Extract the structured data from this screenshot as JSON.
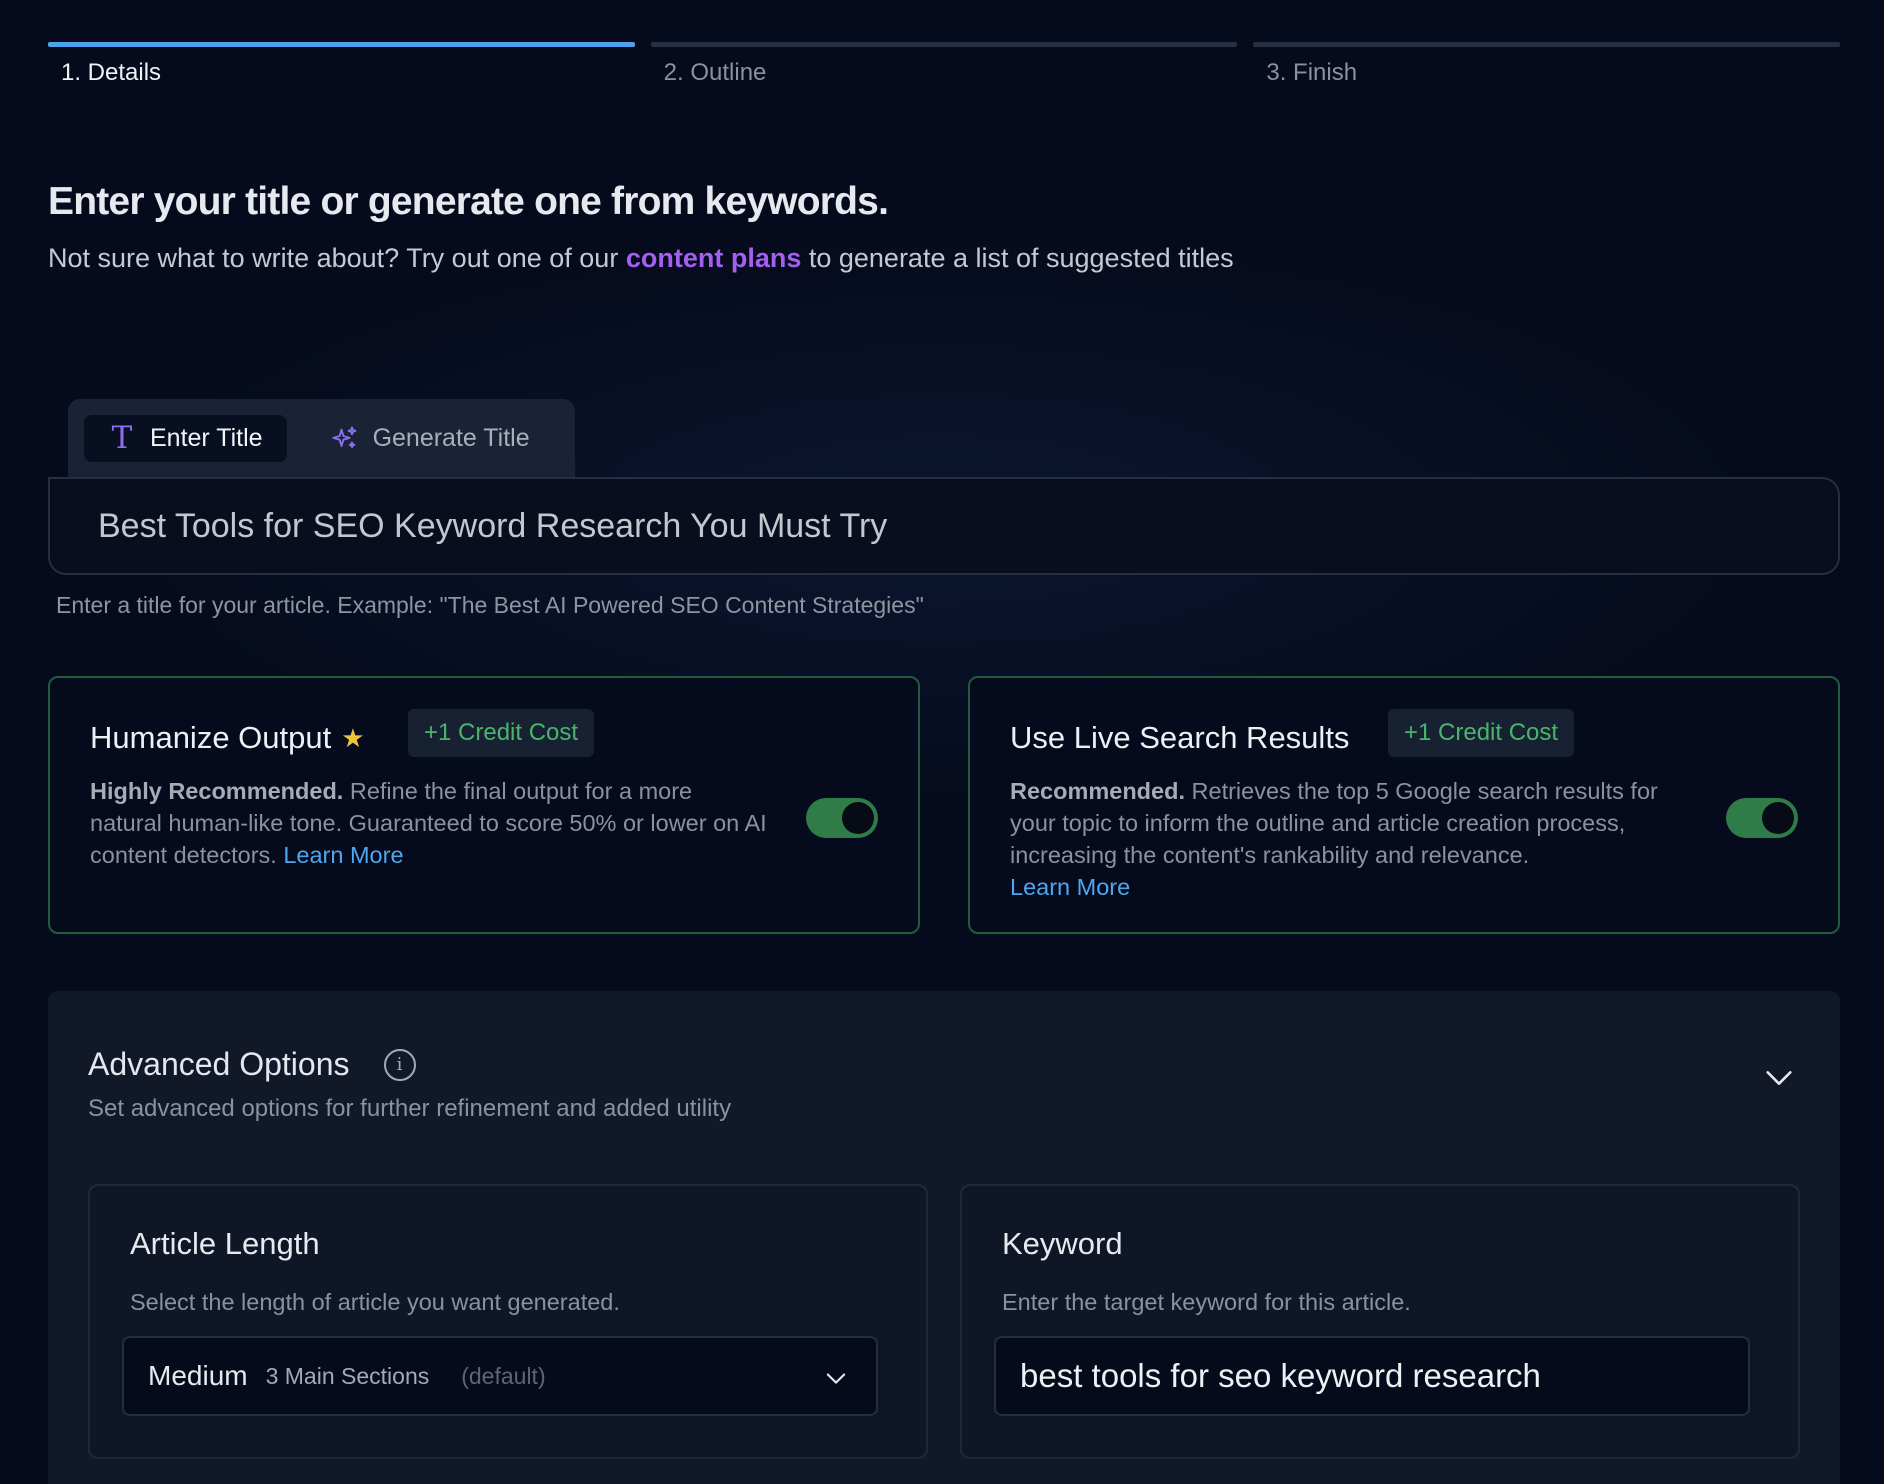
{
  "stepper": {
    "steps": [
      {
        "label": "1. Details",
        "active": true
      },
      {
        "label": "2. Outline",
        "active": false
      },
      {
        "label": "3. Finish",
        "active": false
      }
    ]
  },
  "header": {
    "title": "Enter your title or generate one from keywords.",
    "subtitle_before": "Not sure what to write about? Try out one of our",
    "subtitle_link": "content plans",
    "subtitle_after": "to generate a list of suggested titles"
  },
  "title_tabs": {
    "tabs": [
      {
        "label": "Enter Title",
        "icon": "text-t-icon",
        "active": true
      },
      {
        "label": "Generate Title",
        "icon": "sparkles-icon",
        "active": false
      }
    ],
    "input_value": "Best Tools for SEO Keyword Research You Must Try",
    "help_text": "Enter a title for your article. Example: \"The Best AI Powered SEO Content Strategies\""
  },
  "options": {
    "humanize": {
      "title": "Humanize Output",
      "badge": "+1 Credit Cost",
      "desc_bold": "Highly Recommended.",
      "desc": "Refine the final output for a more natural human-like tone. Guaranteed to score 50% or lower on AI content detectors.",
      "link": "Learn More",
      "enabled": true
    },
    "live_search": {
      "title": "Use Live Search Results",
      "badge": "+1 Credit Cost",
      "desc_bold": "Recommended.",
      "desc": "Retrieves the top 5 Google search results for your topic to inform the outline and article creation process, increasing the content's rankability and relevance.",
      "link": "Learn More",
      "enabled": true
    }
  },
  "advanced": {
    "title": "Advanced Options",
    "subtitle": "Set advanced options for further refinement and added utility",
    "article_length": {
      "title": "Article Length",
      "subtitle": "Select the length of article you want generated.",
      "selected": "Medium",
      "selected_detail": "3 Main Sections",
      "selected_note": "(default)"
    },
    "keyword": {
      "title": "Keyword",
      "subtitle": "Enter the target keyword for this article.",
      "value": "best tools for seo keyword research"
    }
  },
  "colors": {
    "background": "#050b1c",
    "accent_blue": "#4fa3ec",
    "accent_purple": "#a45ef0",
    "success_green": "#48b66a",
    "toggle_on": "#2f7c48"
  }
}
